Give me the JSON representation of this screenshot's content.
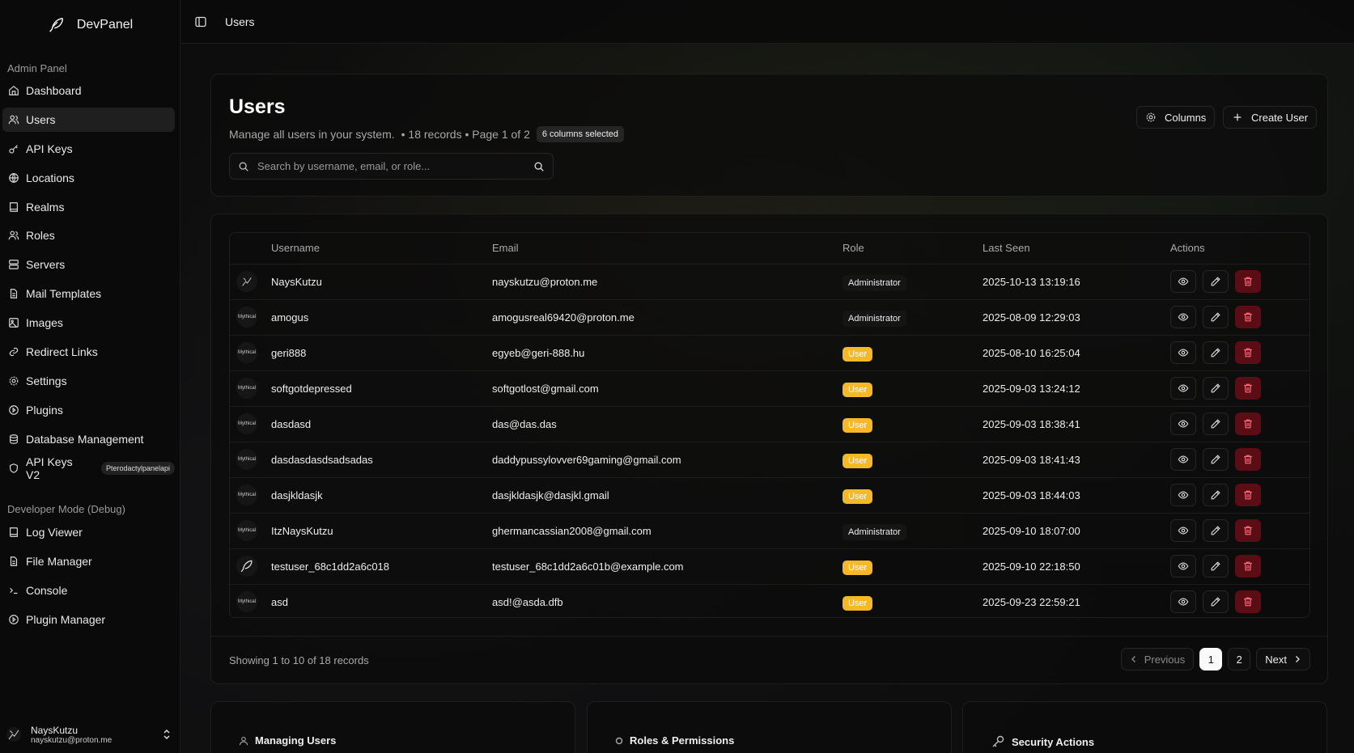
{
  "app": {
    "name": "DevPanel"
  },
  "sidebar": {
    "admin_label": "Admin Panel",
    "items": [
      {
        "label": "Dashboard",
        "icon": "home-icon"
      },
      {
        "label": "Users",
        "icon": "users-icon"
      },
      {
        "label": "API Keys",
        "icon": "key-icon"
      },
      {
        "label": "Locations",
        "icon": "globe-icon"
      },
      {
        "label": "Realms",
        "icon": "book-icon"
      },
      {
        "label": "Roles",
        "icon": "users-icon"
      },
      {
        "label": "Servers",
        "icon": "server-icon"
      },
      {
        "label": "Mail Templates",
        "icon": "file-icon"
      },
      {
        "label": "Images",
        "icon": "image-icon"
      },
      {
        "label": "Redirect Links",
        "icon": "link-icon"
      },
      {
        "label": "Settings",
        "icon": "gear-icon"
      },
      {
        "label": "Plugins",
        "icon": "play-icon"
      },
      {
        "label": "Database Management",
        "icon": "database-icon"
      },
      {
        "label": "API Keys V2",
        "icon": "shield-icon",
        "badge": "Pterodactylpanelapi"
      }
    ],
    "dev_label": "Developer Mode (Debug)",
    "dev_items": [
      {
        "label": "Log Viewer",
        "icon": "book-icon"
      },
      {
        "label": "File Manager",
        "icon": "file-icon"
      },
      {
        "label": "Console",
        "icon": "terminal-icon"
      },
      {
        "label": "Plugin Manager",
        "icon": "play-icon"
      }
    ],
    "user": {
      "name": "NaysKutzu",
      "email": "nayskutzu@proton.me"
    }
  },
  "topbar": {
    "breadcrumb": "Users"
  },
  "header": {
    "title": "Users",
    "subtitle": "Manage all users in your system.",
    "meta": "• 18 records • Page 1 of 2",
    "columns_badge": "6 columns selected",
    "search_placeholder": "Search by username, email, or role...",
    "columns_button": "Columns",
    "create_button": "Create User"
  },
  "table": {
    "headers": [
      "Username",
      "Email",
      "Role",
      "Last Seen",
      "Actions"
    ],
    "rows": [
      {
        "username": "NaysKutzu",
        "email": "nayskutzu@proton.me",
        "role": "Administrator",
        "last_seen": "2025-10-13 13:19:16",
        "avatar": "custom"
      },
      {
        "username": "amogus",
        "email": "amogusreal69420@proton.me",
        "role": "Administrator",
        "last_seen": "2025-08-09 12:29:03",
        "avatar": "Mythical"
      },
      {
        "username": "geri888",
        "email": "egyeb@geri-888.hu",
        "role": "User",
        "last_seen": "2025-08-10 16:25:04",
        "avatar": "Mythical"
      },
      {
        "username": "softgotdepressed",
        "email": "softgotlost@gmail.com",
        "role": "User",
        "last_seen": "2025-09-03 13:24:12",
        "avatar": "Mythical"
      },
      {
        "username": "dasdasd",
        "email": "das@das.das",
        "role": "User",
        "last_seen": "2025-09-03 18:38:41",
        "avatar": "Mythical"
      },
      {
        "username": "dasdasdasdsadsadas",
        "email": "daddypussylovver69gaming@gmail.com",
        "role": "User",
        "last_seen": "2025-09-03 18:41:43",
        "avatar": "Mythical"
      },
      {
        "username": "dasjkldasjk",
        "email": "dasjkldasjk@dasjkl.gmail",
        "role": "User",
        "last_seen": "2025-09-03 18:44:03",
        "avatar": "Mythical"
      },
      {
        "username": "ItzNaysKutzu",
        "email": "ghermancassian2008@gmail.com",
        "role": "Administrator",
        "last_seen": "2025-09-10 18:07:00",
        "avatar": "Mythical"
      },
      {
        "username": "testuser_68c1dd2a6c018",
        "email": "testuser_68c1dd2a6c01b@example.com",
        "role": "User",
        "last_seen": "2025-09-10 22:18:50",
        "avatar": "feather"
      },
      {
        "username": "asd",
        "email": "asd!@asda.dfb",
        "role": "User",
        "last_seen": "2025-09-23 22:59:21",
        "avatar": "Mythical"
      }
    ]
  },
  "footer": {
    "showing": "Showing 1 to 10 of 18 records",
    "previous": "Previous",
    "pages": [
      "1",
      "2"
    ],
    "current_page": "1",
    "next": "Next"
  },
  "info_cards": [
    {
      "title": "Managing Users",
      "icon": "user-icon"
    },
    {
      "title": "Roles & Permissions",
      "icon": "circle-icon"
    },
    {
      "title": "Security Actions",
      "icon": "key-icon"
    }
  ],
  "colors": {
    "user_badge": "#f5b928",
    "delete_button": "#5a0d14",
    "active_nav": "#1f1f1f"
  }
}
